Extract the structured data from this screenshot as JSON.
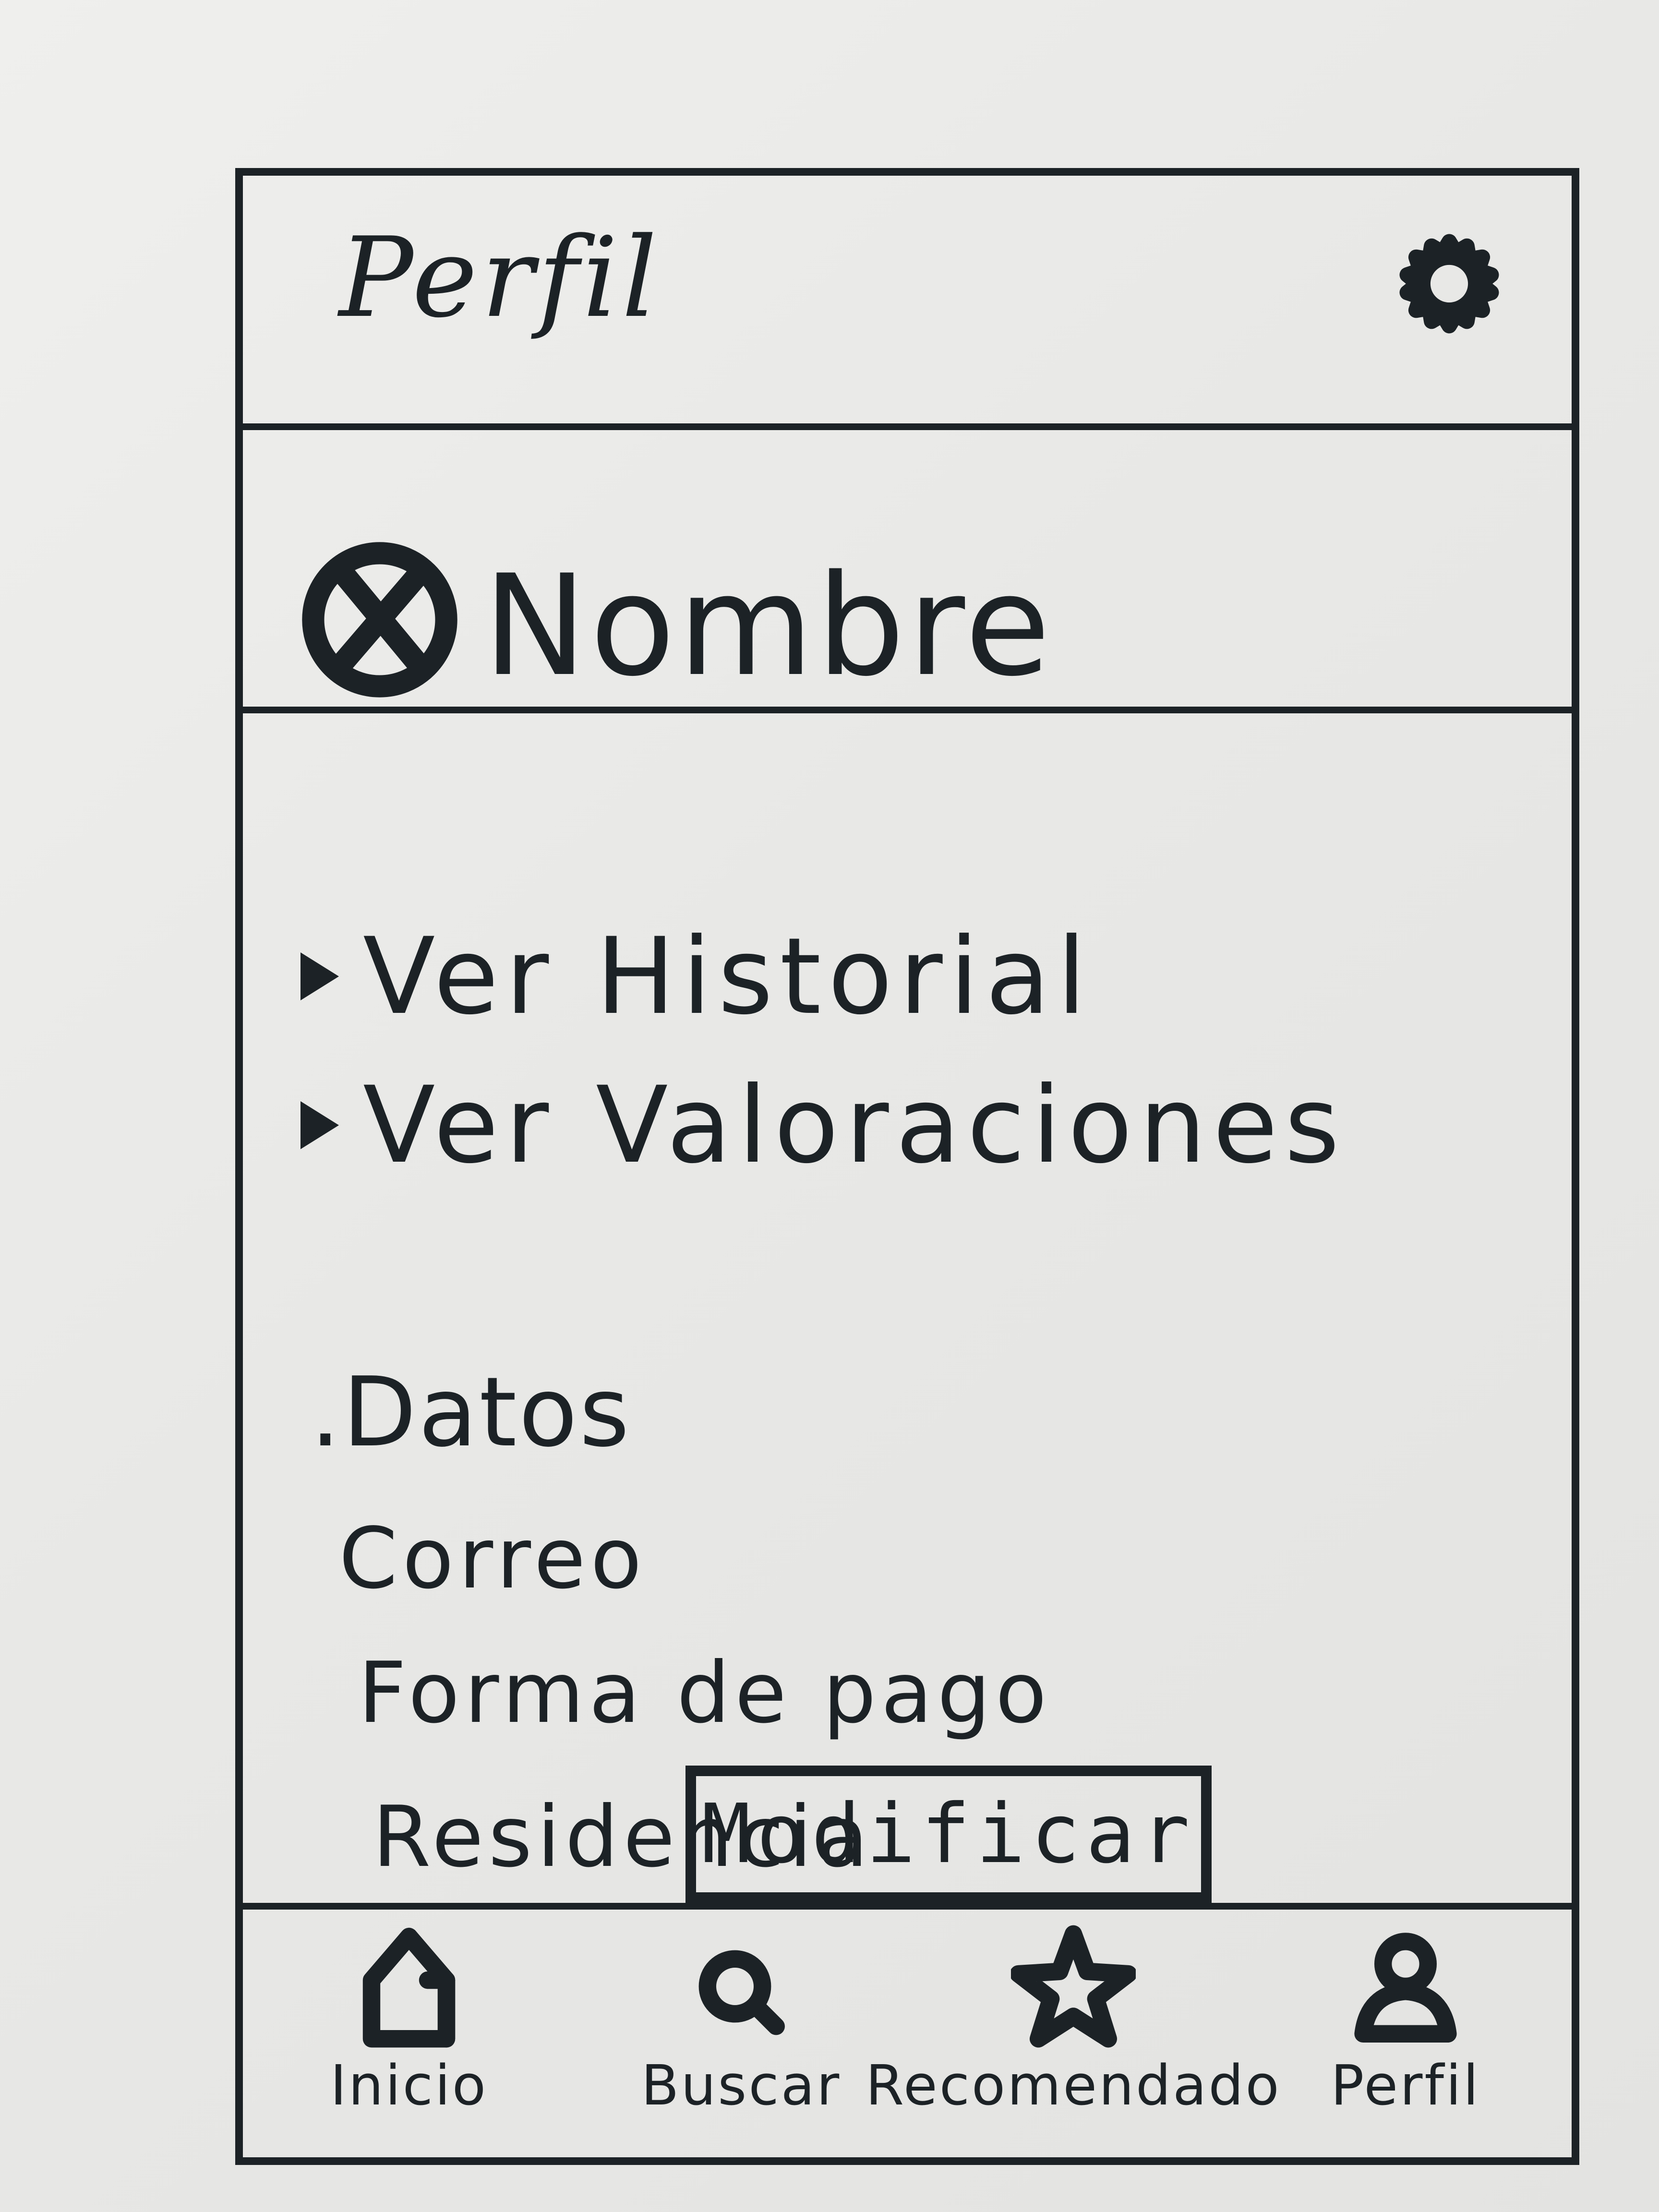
{
  "header": {
    "title": "Perfil",
    "settings_icon": "gear-icon"
  },
  "user": {
    "avatar_icon": "avatar-placeholder-icon",
    "name": "Nombre"
  },
  "links": [
    {
      "label": "Ver Historial",
      "icon": "triangle-bullet-icon"
    },
    {
      "label": "Ver Valoraciones",
      "icon": "triangle-bullet-icon"
    }
  ],
  "datos": {
    "title": ".Datos",
    "fields": [
      "Correo",
      "Forma de pago",
      "Residencia"
    ]
  },
  "modify_button": "Modificar",
  "nav": {
    "items": [
      {
        "label": "Inicio",
        "icon": "home-icon"
      },
      {
        "label": "Buscar",
        "icon": "search-icon"
      },
      {
        "label": "Recomendado",
        "icon": "star-icon"
      },
      {
        "label": "Perfil",
        "icon": "user-icon"
      }
    ]
  }
}
